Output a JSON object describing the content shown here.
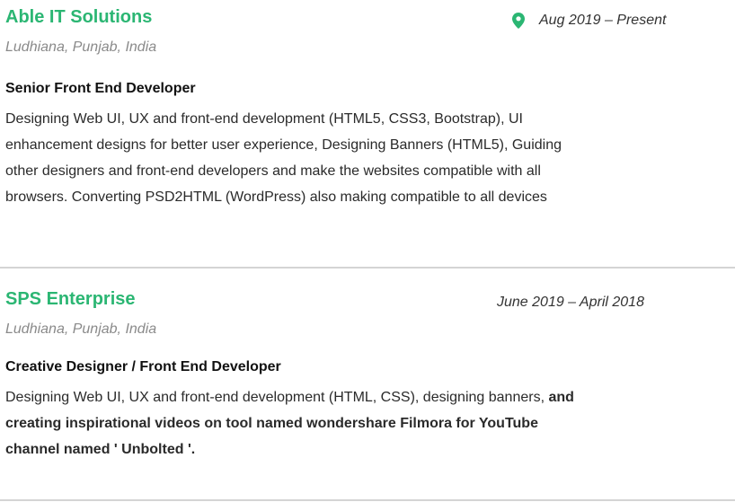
{
  "colors": {
    "accent": "#2bb673",
    "location": "#8a8a8a",
    "divider": "#d4d4d4"
  },
  "jobs": [
    {
      "company": "Able IT Solutions",
      "location": "Ludhiana, Punjab, India",
      "period_icon": "map-marker-icon",
      "period": "Aug 2019 – Present",
      "role": "Senior Front End Developer",
      "description_lines": [
        "Designing Web UI, UX and front-end development (HTML5, CSS3, Bootstrap),  UI",
        "enhancement  designs for better user experience, Designing Banners  (HTML5),  Guiding",
        "other designers  and front-end developers and make the websites compatible with all",
        "browsers. Converting PSD2HTML (WordPress) also making compatible to all devices"
      ]
    },
    {
      "company": "SPS Enterprise",
      "location": "Ludhiana, Punjab, India",
      "period": "June 2019 – April 2018",
      "role": "Creative Designer / Front End Developer",
      "description_plain": "Designing Web UI, UX and front-end development (HTML, CSS), designing banners, ",
      "description_bold_1": "and",
      "description_bold_2": "creating inspirational videos on tool named wondershare Filmora for YouTube",
      "description_bold_3": "channel named ' Unbolted '."
    }
  ]
}
